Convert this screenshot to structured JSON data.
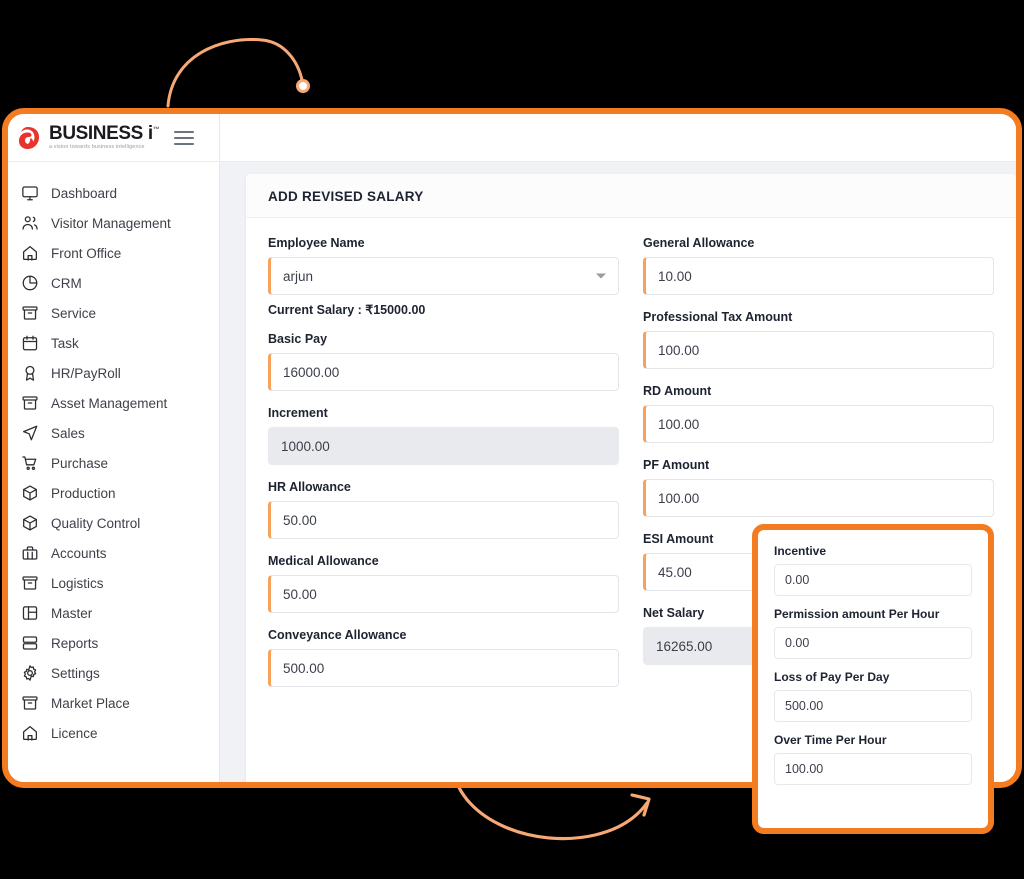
{
  "brand": {
    "name": "BUSINESS i",
    "tm": "™",
    "tagline": "a vision towards business intelligence",
    "logo_icon": "business-i-logo-icon",
    "menu_icon": "hamburger-menu-icon"
  },
  "colors": {
    "accent": "#F47B20",
    "accent_light": "#F6A15C",
    "logo_red": "#E8342A",
    "text_dark": "#1d2330",
    "field_border": "#e3e5ea",
    "disabled_bg": "#e8eaee",
    "canvas": "#f1f2f5"
  },
  "sidebar": {
    "items": [
      {
        "label": "Dashboard",
        "icon": "monitor-icon"
      },
      {
        "label": "Visitor Management",
        "icon": "users-icon"
      },
      {
        "label": "Front Office",
        "icon": "home-icon"
      },
      {
        "label": "CRM",
        "icon": "pie-chart-icon"
      },
      {
        "label": "Service",
        "icon": "archive-box-icon"
      },
      {
        "label": "Task",
        "icon": "calendar-icon"
      },
      {
        "label": "HR/PayRoll",
        "icon": "award-badge-icon"
      },
      {
        "label": "Asset Management",
        "icon": "archive-box-icon"
      },
      {
        "label": "Sales",
        "icon": "send-paper-plane-icon"
      },
      {
        "label": "Purchase",
        "icon": "shopping-cart-icon"
      },
      {
        "label": "Production",
        "icon": "cube-box-icon"
      },
      {
        "label": "Quality Control",
        "icon": "cube-box-icon"
      },
      {
        "label": "Accounts",
        "icon": "briefcase-icon"
      },
      {
        "label": "Logistics",
        "icon": "archive-box-icon"
      },
      {
        "label": "Master",
        "icon": "layout-panel-icon"
      },
      {
        "label": "Reports",
        "icon": "server-stack-icon"
      },
      {
        "label": "Settings",
        "icon": "gear-icon"
      },
      {
        "label": "Market Place",
        "icon": "archive-box-icon"
      },
      {
        "label": "Licence",
        "icon": "home-icon"
      }
    ]
  },
  "card": {
    "title": "ADD REVISED SALARY"
  },
  "form": {
    "left_column": [
      {
        "label": "Employee Name",
        "value": "arjun",
        "type": "select",
        "disabled": false
      },
      {
        "label": "Basic Pay",
        "value": "16000.00",
        "type": "text",
        "disabled": false
      },
      {
        "label": "Increment",
        "value": "1000.00",
        "type": "text",
        "disabled": true
      },
      {
        "label": "HR Allowance",
        "value": "50.00",
        "type": "text",
        "disabled": false
      },
      {
        "label": "Medical Allowance",
        "value": "50.00",
        "type": "text",
        "disabled": false
      },
      {
        "label": "Conveyance Allowance",
        "value": "500.00",
        "type": "text",
        "disabled": false
      }
    ],
    "current_salary_note": "Current Salary :  ₹15000.00",
    "right_column": [
      {
        "label": "General Allowance",
        "value": "10.00",
        "type": "text",
        "disabled": false
      },
      {
        "label": "Professional Tax Amount",
        "value": "100.00",
        "type": "text",
        "disabled": false
      },
      {
        "label": "RD Amount",
        "value": "100.00",
        "type": "text",
        "disabled": false
      },
      {
        "label": "PF Amount",
        "value": "100.00",
        "type": "text",
        "disabled": false
      },
      {
        "label": "ESI Amount",
        "value": "45.00",
        "type": "text",
        "disabled": false
      },
      {
        "label": "Net Salary",
        "value": "16265.00",
        "type": "text",
        "disabled": true
      }
    ]
  },
  "overlay_panel": {
    "fields": [
      {
        "label": "Incentive",
        "value": "0.00"
      },
      {
        "label": "Permission amount Per Hour",
        "value": "0.00"
      },
      {
        "label": "Loss of Pay Per Day",
        "value": "500.00"
      },
      {
        "label": "Over Time Per Hour",
        "value": "100.00"
      }
    ]
  },
  "decorations": {
    "top_arc": "curved-arc-with-dot",
    "bottom_arrow": "curved-arrow-pointing-up-right"
  }
}
